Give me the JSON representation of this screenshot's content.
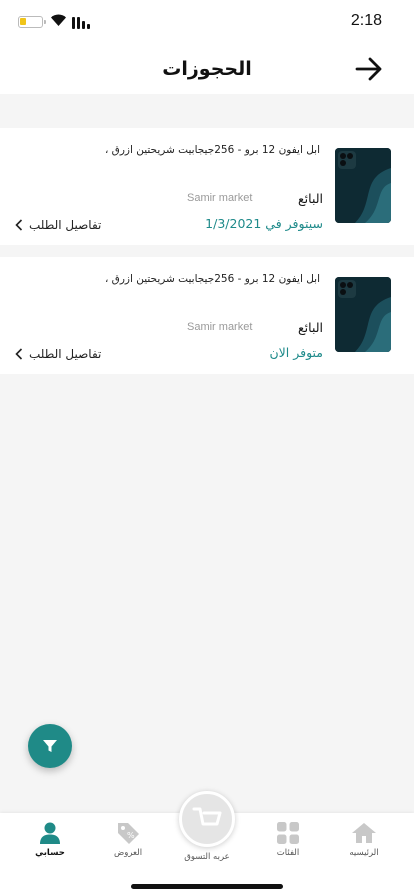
{
  "status_bar": {
    "time": "2:18"
  },
  "header": {
    "title": "الحجوزات"
  },
  "orders": [
    {
      "product_name": "ابل ايفون 12 برو - 256جيجابيت شريحتين ازرق ،",
      "seller_label": "البائع",
      "seller_name": "Samir market",
      "availability": "سيتوفر  في 1/3/2021",
      "details_label": "تفاصيل الطلب"
    },
    {
      "product_name": "ابل ايفون 12 برو - 256جيجابيت شريحتين ازرق ،",
      "seller_label": "البائع",
      "seller_name": "Samir market",
      "availability": "متوفر الان",
      "details_label": "تفاصيل الطلب"
    }
  ],
  "tabbar": {
    "home": "الرئيسيه",
    "categories": "الفئات",
    "cart": "عربه التسوق",
    "offers": "العروض",
    "account": "حسابي"
  },
  "colors": {
    "accent": "#1f8a87",
    "availability": "#1e8a8a"
  },
  "icons": [
    "battery-icon",
    "wifi-icon",
    "signal-icon",
    "back-arrow-icon",
    "chevron-left-icon",
    "filter-icon",
    "home-icon",
    "categories-icon",
    "cart-icon",
    "offers-icon",
    "account-icon"
  ]
}
